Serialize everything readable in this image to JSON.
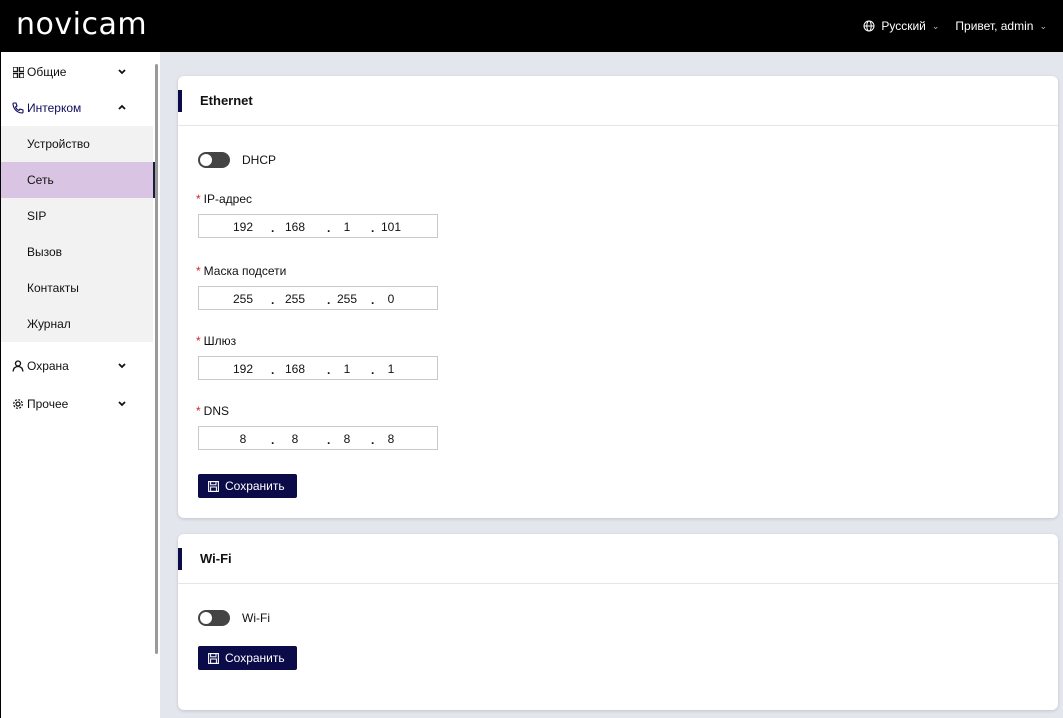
{
  "header": {
    "logo": "novicam",
    "language": "Русский",
    "greeting": "Привет, admin"
  },
  "sidebar": {
    "items": [
      {
        "label": "Общие",
        "icon": "grid-icon"
      },
      {
        "label": "Интерком",
        "icon": "phone-icon"
      },
      {
        "label": "Охрана",
        "icon": "user-icon"
      },
      {
        "label": "Прочее",
        "icon": "gear-icon"
      }
    ],
    "sub_items": [
      "Устройство",
      "Сеть",
      "SIP",
      "Вызов",
      "Контакты",
      "Журнал"
    ],
    "active_sub": "Сеть"
  },
  "ethernet": {
    "title": "Ethernet",
    "dhcp_label": "DHCP",
    "dhcp_on": false,
    "fields": [
      {
        "label": "IP-адрес",
        "octets": [
          "192",
          "168",
          "1",
          "101"
        ]
      },
      {
        "label": "Маска подсети",
        "octets": [
          "255",
          "255",
          "255",
          "0"
        ]
      },
      {
        "label": "Шлюз",
        "octets": [
          "192",
          "168",
          "1",
          "1"
        ]
      },
      {
        "label": "DNS",
        "octets": [
          "8",
          "8",
          "8",
          "8"
        ]
      }
    ],
    "required_mark": "*",
    "save_label": "Сохранить"
  },
  "wifi": {
    "title": "Wi-Fi",
    "toggle_label": "Wi-Fi",
    "toggle_on": false,
    "save_label": "Сохранить"
  },
  "colors": {
    "accent": "#0b0b4a",
    "active_bg": "#d9c5e3",
    "required": "#dd2222"
  }
}
